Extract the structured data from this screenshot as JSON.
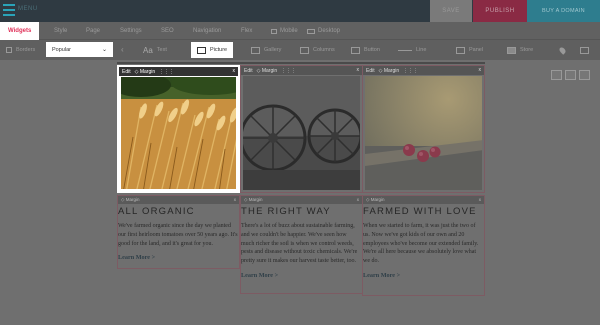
{
  "topbar": {
    "menu_label": "MENU",
    "save_label": "SAVE",
    "publish_label": "PUBLISH",
    "domain_label": "BUY A DOMAIN"
  },
  "tabs": [
    {
      "label": "Widgets",
      "active": true
    },
    {
      "label": "Style"
    },
    {
      "label": "Page"
    },
    {
      "label": "Settings"
    },
    {
      "label": "SEO"
    },
    {
      "label": "Navigation"
    },
    {
      "label": "Flex"
    },
    {
      "label": "Mobile"
    },
    {
      "label": "Desktop"
    }
  ],
  "toolbar": {
    "borders_label": "Borders",
    "category_selected": "Popular",
    "items": [
      {
        "label": "Text",
        "icon": "text-icon"
      },
      {
        "label": "Picture",
        "icon": "picture-icon"
      },
      {
        "label": "Gallery",
        "icon": "gallery-icon"
      },
      {
        "label": "Columns",
        "icon": "columns-icon"
      },
      {
        "label": "Button",
        "icon": "button-icon"
      },
      {
        "label": "Line",
        "icon": "line-icon"
      },
      {
        "label": "Panel",
        "icon": "panel-icon"
      },
      {
        "label": "Store",
        "icon": "store-icon"
      }
    ]
  },
  "editor": {
    "edit_label": "Edit",
    "margin_label": "Margin",
    "close": "x"
  },
  "columns": [
    {
      "heading": "ALL ORGANIC",
      "body": "We've farmed organic since the day we planted our first heirloom tomatoes over 50 years ago. It's good for the land, and it's great for you.",
      "link": "Learn More >"
    },
    {
      "heading": "THE RIGHT WAY",
      "body": "There's a lot of buzz about sustainable farming, and we couldn't be happier. We've seen how much richer the soil is when we control weeds, pests and disease without toxic chemicals. We're pretty sure it makes our harvest taste better, too.",
      "link": "Learn More >"
    },
    {
      "heading": "FARMED WITH LOVE",
      "body": "When we started to farm, it was just the two of us. Now we've got kids of our own and 20 employees who've become our extended family. We're all here because we absolutely love what we do.",
      "link": "Learn More >"
    }
  ]
}
